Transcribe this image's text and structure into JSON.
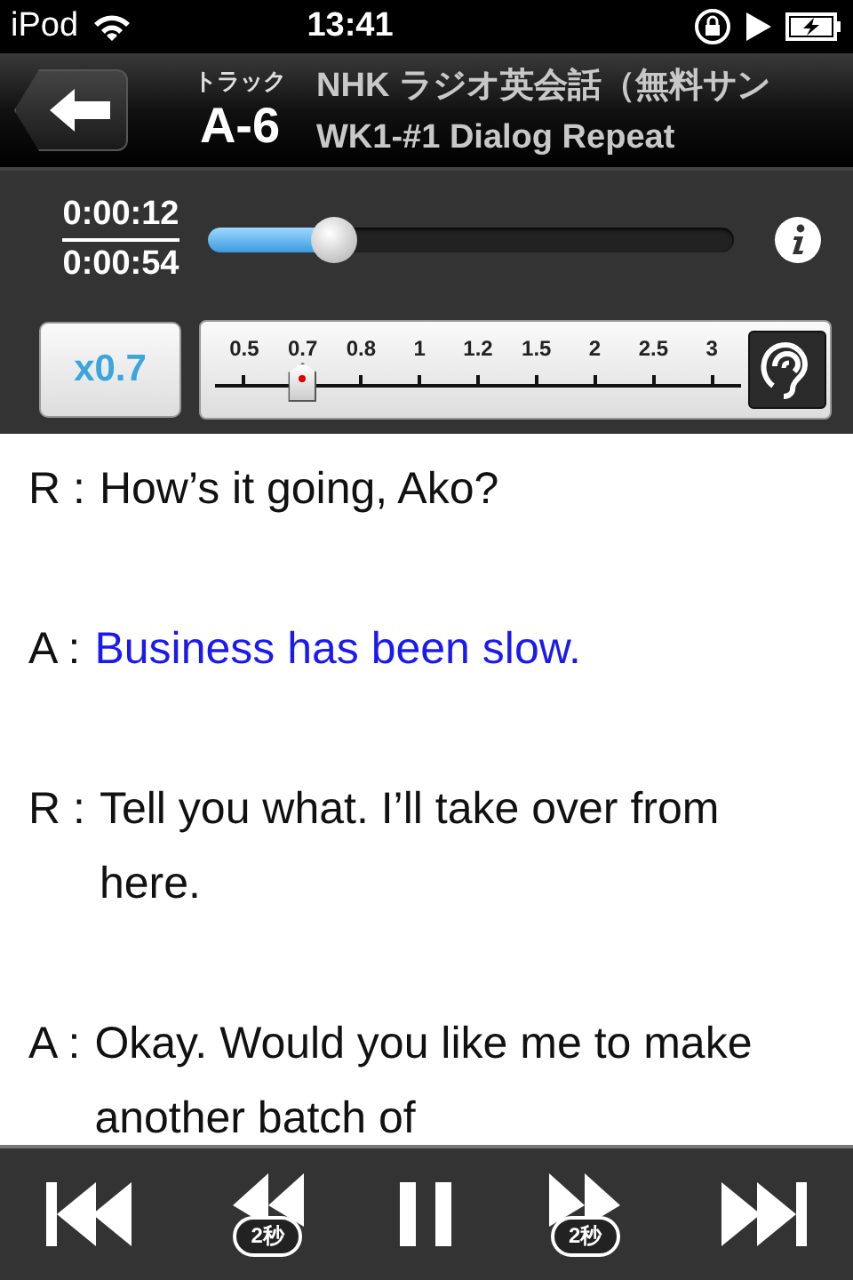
{
  "status_bar": {
    "carrier": "iPod",
    "time": "13:41"
  },
  "header": {
    "track_label": "トラック",
    "track_number": "A-6",
    "album": "NHK ラジオ英会話（無料サン",
    "title": "WK1-#1 Dialog Repeat"
  },
  "player": {
    "elapsed": "0:00:12",
    "total": "0:00:54",
    "level": 0.24,
    "speed_button": "x0.7",
    "speeds": [
      {
        "label": "0.5",
        "selected": false
      },
      {
        "label": "0.7",
        "selected": true
      },
      {
        "label": "0.8",
        "selected": false
      },
      {
        "label": "1",
        "selected": false
      },
      {
        "label": "1.2",
        "selected": false
      },
      {
        "label": "1.5",
        "selected": false
      },
      {
        "label": "2",
        "selected": false
      },
      {
        "label": "2.5",
        "selected": false
      },
      {
        "label": "3",
        "selected": false
      }
    ]
  },
  "dialog": [
    {
      "speaker": "R :",
      "text": "How’s it going, Ako?",
      "selected": false
    },
    {
      "speaker": "A :",
      "text": "Business has been slow.",
      "selected": true
    },
    {
      "speaker": "R :",
      "text": "Tell you what. I’ll take over from here.",
      "selected": false
    },
    {
      "speaker": "A :",
      "text": "Okay. Would you like me to make another batch of",
      "selected": false
    }
  ],
  "controls": [
    {
      "kind": "first"
    },
    {
      "kind": "back",
      "label": "2秒"
    },
    {
      "kind": "pause"
    },
    {
      "kind": "forward",
      "label": "2秒"
    },
    {
      "kind": "last"
    }
  ]
}
